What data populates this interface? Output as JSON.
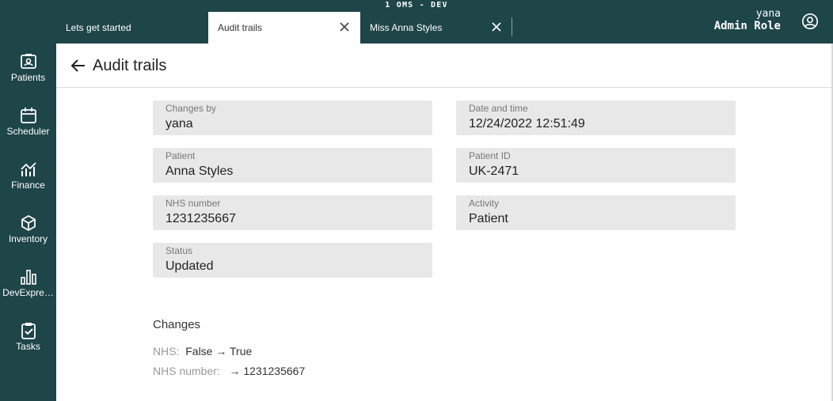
{
  "env": "1 OMS - DEV",
  "tabs": [
    {
      "label": "Lets get started"
    },
    {
      "label": "Audit trails"
    },
    {
      "label": "Miss Anna Styles"
    }
  ],
  "user": {
    "name": "yana",
    "role": "Admin Role"
  },
  "sidebar": {
    "items": [
      {
        "label": "Patients",
        "icon": "patients-icon"
      },
      {
        "label": "Scheduler",
        "icon": "calendar-icon"
      },
      {
        "label": "Finance",
        "icon": "finance-chart-icon"
      },
      {
        "label": "Inventory",
        "icon": "box-icon"
      },
      {
        "label": "DevExpre…",
        "icon": "bar-chart-icon"
      },
      {
        "label": "Tasks",
        "icon": "clipboard-check-icon"
      }
    ]
  },
  "page": {
    "title": "Audit trails"
  },
  "fields": {
    "changes_by": {
      "label": "Changes by",
      "value": "yana"
    },
    "date_time": {
      "label": "Date and time",
      "value": "12/24/2022 12:51:49"
    },
    "patient": {
      "label": "Patient",
      "value": "Anna Styles"
    },
    "patient_id": {
      "label": "Patient ID",
      "value": "UK-2471"
    },
    "nhs_number": {
      "label": "NHS number",
      "value": "1231235667"
    },
    "activity": {
      "label": "Activity",
      "value": "Patient"
    },
    "status": {
      "label": "Status",
      "value": "Updated"
    }
  },
  "changes": {
    "title": "Changes",
    "rows": [
      {
        "key": "NHS:",
        "old": "False",
        "arrow": "→",
        "new": "True"
      },
      {
        "key": "NHS number:",
        "old": "",
        "arrow": "→",
        "new": "1231235667"
      }
    ]
  },
  "colors": {
    "sidebar": "#1e4548",
    "field_bg": "#e8e8e8"
  }
}
